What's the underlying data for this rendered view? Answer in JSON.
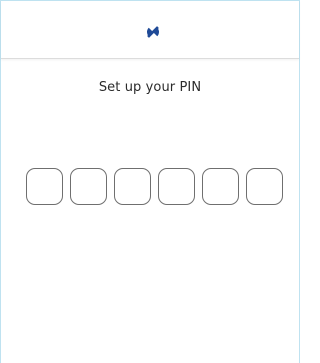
{
  "header": {
    "logo_icon": "brand-logo-icon",
    "brand_color": "#1f4a97"
  },
  "main": {
    "title": "Set up your PIN",
    "pin": {
      "length": 6,
      "digits": [
        "",
        "",
        "",
        "",
        "",
        ""
      ]
    }
  }
}
